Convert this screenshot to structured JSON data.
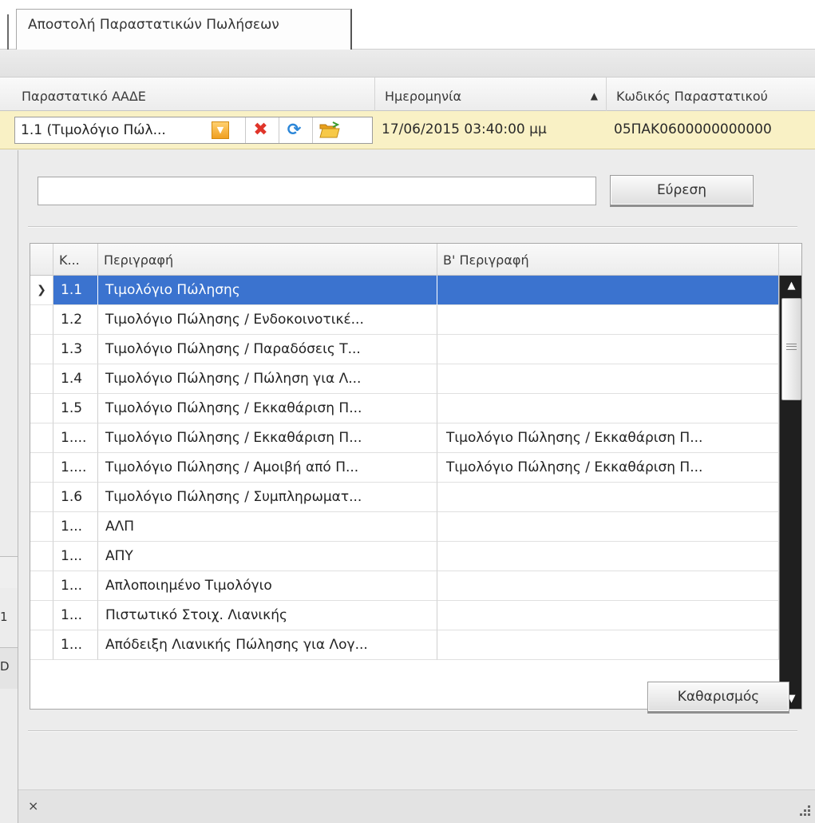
{
  "tab": {
    "label": "Αποστολή Παραστατικών Πωλήσεων"
  },
  "grid": {
    "headers": [
      "Παραστατικό ΑΑΔΕ",
      "Ημερομηνία",
      "Κωδικός Παραστατικού"
    ],
    "sort_indicator": "▲",
    "edit_row": {
      "combo_value": "1.1 (Τιμολόγιο Πώλ...",
      "date": "17/06/2015 03:40:00 μμ",
      "code": "05ΠΑΚ0600000000000"
    }
  },
  "background_fragments": [
    "1",
    "D"
  ],
  "popup": {
    "search": {
      "value": "",
      "placeholder": ""
    },
    "search_button": "Εύρεση",
    "lookup_headers": [
      "Κ...",
      "Περιγραφή",
      "Β' Περιγραφή"
    ],
    "rows": [
      {
        "code": "1.1",
        "desc": "Τιμολόγιο Πώλησης",
        "desc2": "",
        "selected": true
      },
      {
        "code": "1.2",
        "desc": "Τιμολόγιο Πώλησης / Ενδοκοινοτικέ...",
        "desc2": ""
      },
      {
        "code": "1.3",
        "desc": "Τιμολόγιο Πώλησης / Παραδόσεις Τ...",
        "desc2": ""
      },
      {
        "code": "1.4",
        "desc": "Τιμολόγιο Πώλησης / Πώληση για Λ...",
        "desc2": ""
      },
      {
        "code": "1.5",
        "desc": "Τιμολόγιο Πώλησης / Εκκαθάριση Π...",
        "desc2": ""
      },
      {
        "code": "1....",
        "desc": "Τιμολόγιο Πώλησης / Εκκαθάριση Π...",
        "desc2": "Τιμολόγιο Πώλησης / Εκκαθάριση Π..."
      },
      {
        "code": "1....",
        "desc": "Τιμολόγιο Πώλησης / Αμοιβή από Π...",
        "desc2": "Τιμολόγιο Πώλησης / Εκκαθάριση Π..."
      },
      {
        "code": "1.6",
        "desc": "Τιμολόγιο Πώλησης / Συμπληρωματ...",
        "desc2": ""
      },
      {
        "code": "1...",
        "desc": "ΑΛΠ",
        "desc2": ""
      },
      {
        "code": "1...",
        "desc": "ΑΠΥ",
        "desc2": ""
      },
      {
        "code": "1...",
        "desc": "Απλοποιημένο Τιμολόγιο",
        "desc2": ""
      },
      {
        "code": "1...",
        "desc": "Πιστωτικό Στοιχ. Λιανικής",
        "desc2": ""
      },
      {
        "code": "1...",
        "desc": "Απόδειξη Λιανικής Πώλησης για Λογ...",
        "desc2": ""
      }
    ],
    "clear_button": "Καθαρισμός",
    "close_label": "×"
  }
}
